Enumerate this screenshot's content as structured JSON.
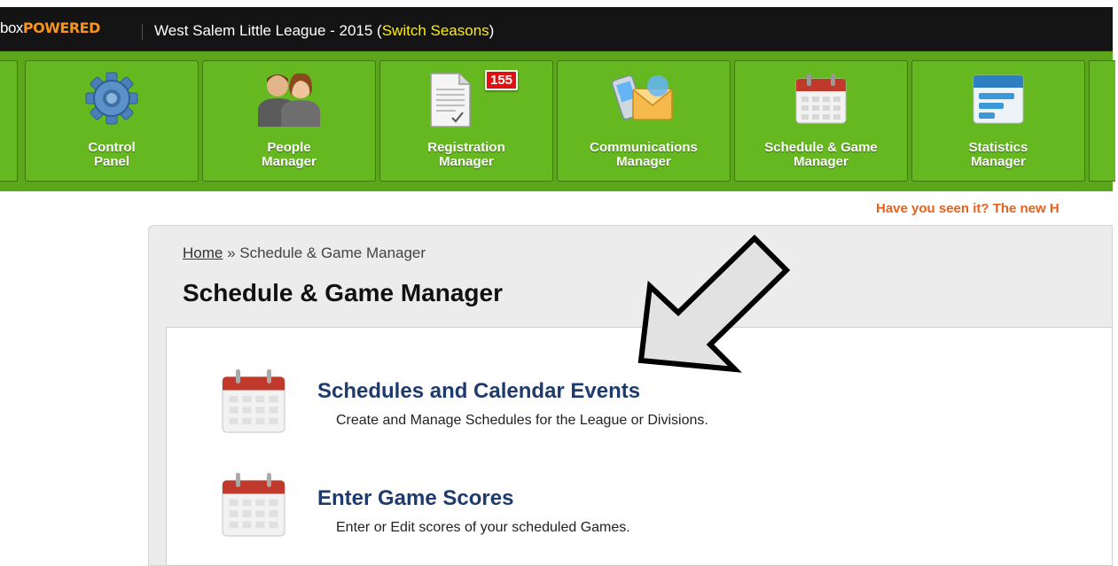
{
  "brand": {
    "prefix": "box",
    "suffix": "POWERED"
  },
  "league": {
    "name": "West Salem Little League - 2015 (",
    "switch_label": "Switch Seasons",
    "close": ")"
  },
  "toolbar": {
    "items": [
      {
        "line1": "Control",
        "line2": "Panel",
        "icon": "gear-icon"
      },
      {
        "line1": "People",
        "line2": "Manager",
        "icon": "people-icon"
      },
      {
        "line1": "Registration",
        "line2": "Manager",
        "icon": "document-icon",
        "badge": "155"
      },
      {
        "line1": "Communications",
        "line2": "Manager",
        "icon": "phone-mail-icon"
      },
      {
        "line1": "Schedule & Game",
        "line2": "Manager",
        "icon": "calendar-icon"
      },
      {
        "line1": "Statistics",
        "line2": "Manager",
        "icon": "stats-icon"
      }
    ]
  },
  "promo": "Have you seen it? The new H",
  "breadcrumb": {
    "home": "Home",
    "sep": " » ",
    "current": "Schedule & Game Manager"
  },
  "page_title": "Schedule & Game Manager",
  "menu": [
    {
      "title": "Schedules and Calendar Events",
      "desc": "Create and Manage Schedules for the League or Divisions.",
      "icon": "calendar-icon"
    },
    {
      "title": "Enter Game Scores",
      "desc": "Enter or Edit scores of your scheduled Games.",
      "icon": "calendar-icon"
    }
  ],
  "colors": {
    "toolbar_green": "#5ca61c",
    "link_blue": "#1e3b6e",
    "promo_orange": "#e8611c",
    "badge_red": "#e01010",
    "switch_yellow": "#ffec00"
  }
}
